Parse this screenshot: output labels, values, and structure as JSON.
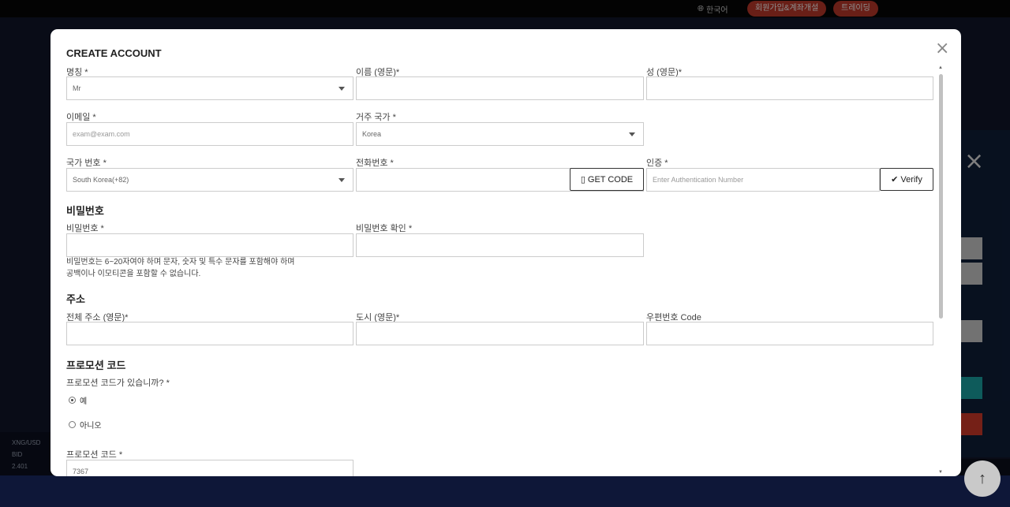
{
  "background": {
    "language_label": "한국어",
    "join_label": "회원가입&계좌개설",
    "trading_label": "트레이딩",
    "ticker": {
      "symbol": "XNG/USD",
      "bid_label": "BID",
      "bid_value": "2.401"
    }
  },
  "modal": {
    "title": "CREATE ACCOUNT",
    "close_glyph": "×",
    "personal": {
      "salutation": {
        "label": "명칭 *",
        "value": "Mr"
      },
      "first_name": {
        "label": "이름 (영문)*",
        "value": ""
      },
      "last_name": {
        "label": "성 (영문)*",
        "value": ""
      },
      "email": {
        "label": "이메일 *",
        "placeholder": "exam@exam.com"
      },
      "country": {
        "label": "거주 국가 *",
        "value": "Korea"
      },
      "country_code": {
        "label": "국가 번호 *",
        "value": "South Korea(+82)"
      },
      "phone": {
        "label": "전화번호 *",
        "value": ""
      },
      "get_code_label": "GET CODE",
      "auth": {
        "label": "인증 *",
        "placeholder": "Enter Authentication Number"
      },
      "verify_label": "Verify"
    },
    "password_section": {
      "heading": "비밀번호",
      "password": {
        "label": "비밀번호 *"
      },
      "confirm": {
        "label": "비밀번호 확인 *"
      },
      "hint_line1": "비밀번호는 6~20자여야 하며 문자, 숫자 및 특수 문자를 포함해야 하며",
      "hint_line2": "공백이나 이모티콘을 포함할 수 없습니다."
    },
    "address_section": {
      "heading": "주소",
      "full_address": {
        "label": "전체 주소 (영문)*"
      },
      "city": {
        "label": "도시 (영문)*"
      },
      "postal": {
        "label": "우편번호 Code"
      }
    },
    "promo_section": {
      "heading": "프로모션 코드",
      "question": "프로모션 코드가 있습니까? *",
      "options": [
        {
          "label": "예",
          "selected": true
        },
        {
          "label": "아니오",
          "selected": false
        }
      ],
      "code": {
        "label": "프로모션 코드 *",
        "value": "7367"
      }
    }
  }
}
